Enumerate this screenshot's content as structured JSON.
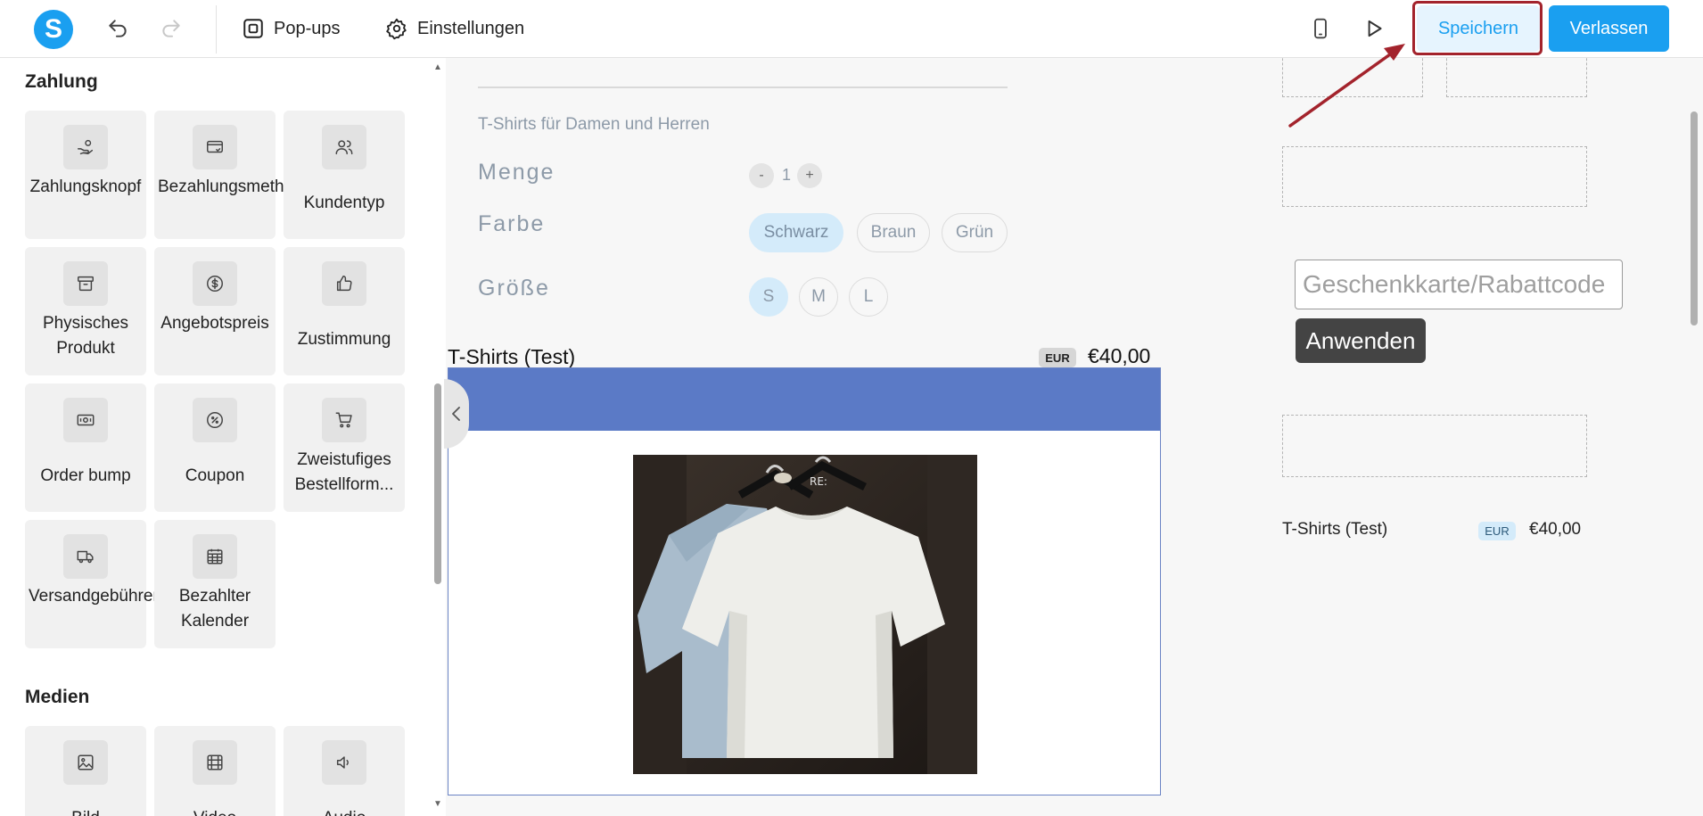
{
  "toolbar": {
    "logo_letter": "S",
    "popups_label": "Pop-ups",
    "settings_label": "Einstellungen",
    "save_label": "Speichern",
    "leave_label": "Verlassen",
    "accent_color": "#1a9ff0",
    "highlight_color": "#a3232c"
  },
  "sidebar": {
    "payment_title": "Zahlung",
    "media_title": "Medien",
    "payment_items": [
      {
        "label": "Zahlungsknopf",
        "icon": "hand-coin-icon"
      },
      {
        "label": "Bezahlungsmethode",
        "icon": "credit-card-icon"
      },
      {
        "label": "Kundentyp",
        "icon": "users-icon"
      },
      {
        "label": "Physisches Produkt",
        "icon": "archive-box-icon"
      },
      {
        "label": "Angebotspreis",
        "icon": "dollar-circle-icon"
      },
      {
        "label": "Zustimmung",
        "icon": "thumbs-up-icon"
      },
      {
        "label": "Order bump",
        "icon": "banknote-icon"
      },
      {
        "label": "Coupon",
        "icon": "discount-icon"
      },
      {
        "label": "Zweistufiges Bestellform...",
        "icon": "cart-icon"
      },
      {
        "label": "Versandgebühren",
        "icon": "truck-icon"
      },
      {
        "label": "Bezahlter Kalender",
        "icon": "calendar-icon"
      }
    ],
    "media_items": [
      {
        "label": "Bild",
        "icon": "image-icon"
      },
      {
        "label": "Video",
        "icon": "video-icon"
      },
      {
        "label": "Audio",
        "icon": "speaker-icon"
      }
    ]
  },
  "canvas": {
    "product_subtitle": "T-Shirts für Damen und Herren",
    "quantity_label": "Menge",
    "quantity_minus": "-",
    "quantity_value": "1",
    "quantity_plus": "+",
    "color_label": "Farbe",
    "colors": [
      "Schwarz",
      "Braun",
      "Grün"
    ],
    "selected_color": "Schwarz",
    "size_label": "Größe",
    "sizes": [
      "S",
      "M",
      "L"
    ],
    "selected_size": "S",
    "product_title": "T-Shirts (Test)",
    "currency_badge": "EUR",
    "product_price": "€40,00",
    "band_color": "#5b7ac6",
    "gift_placeholder": "Geschenkkarte/Rabattcode",
    "apply_label": "Anwenden",
    "summary_title": "T-Shirts (Test)",
    "summary_currency": "EUR",
    "summary_price": "€40,00"
  }
}
